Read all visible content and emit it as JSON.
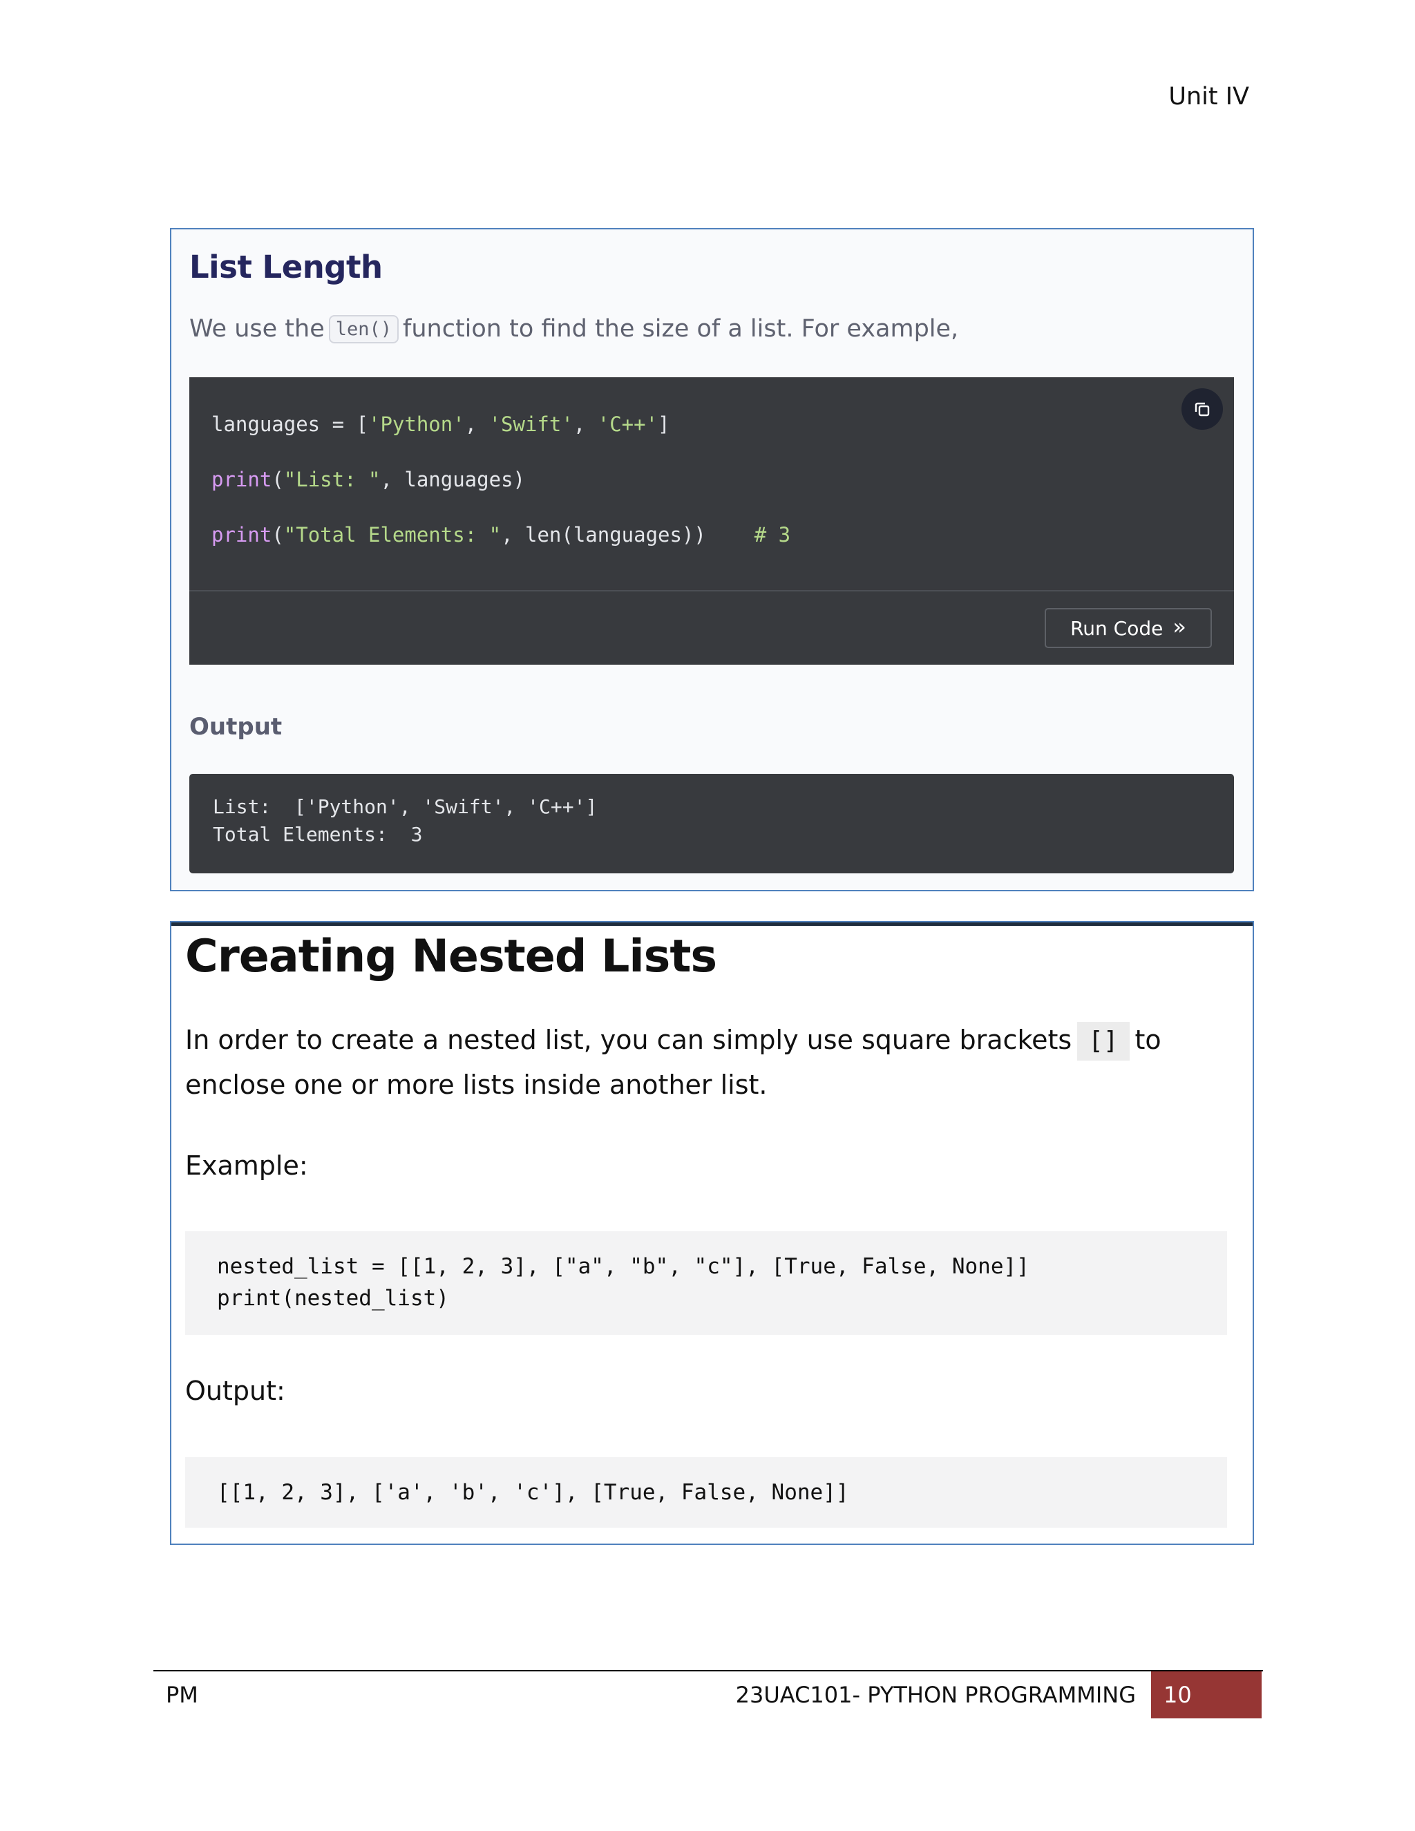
{
  "header": {
    "unit": "Unit IV"
  },
  "list_length": {
    "title": "List Length",
    "intro_before": "We use the",
    "intro_code": "len()",
    "intro_after": "function to find the size of a list. For example,",
    "code": {
      "line1_a": "languages = [",
      "line1_s1": "'Python'",
      "line1_sep1": ", ",
      "line1_s2": "'Swift'",
      "line1_sep2": ", ",
      "line1_s3": "'C++'",
      "line1_end": "]",
      "line2_kw": "print",
      "line2_a": "(",
      "line2_s": "\"List: \"",
      "line2_b": ", languages)",
      "line3_kw": "print",
      "line3_a": "(",
      "line3_s": "\"Total Elements: \"",
      "line3_b": ", len(languages))    ",
      "line3_cmt": "# 3"
    },
    "copy_icon": "copy-icon",
    "run_label": "Run Code",
    "run_icon": "double-chevron-right-icon",
    "output_heading": "Output",
    "output_lines": [
      "List:  ['Python', 'Swift', 'C++']",
      "Total Elements:  3"
    ]
  },
  "nested_lists": {
    "title": "Creating Nested Lists",
    "para_before": "In order to create a nested list, you can simply use square brackets",
    "para_code": "[]",
    "para_after": "to enclose one or more lists inside another list.",
    "example_label": "Example:",
    "example_lines": [
      "nested_list = [[1, 2, 3], [\"a\", \"b\", \"c\"], [True, False, None]]",
      "print(nested_list)"
    ],
    "output_label": "Output:",
    "output_lines": [
      "[[1, 2, 3], ['a', 'b', 'c'], [True, False, None]]"
    ]
  },
  "footer": {
    "left": "PM",
    "course": "23UAC101- PYTHON PROGRAMMING",
    "page": "10"
  },
  "colors": {
    "box_border": "#4f81bd",
    "code_bg": "#383a3e",
    "page_box": "#963634",
    "title_dark": "#25265e"
  }
}
